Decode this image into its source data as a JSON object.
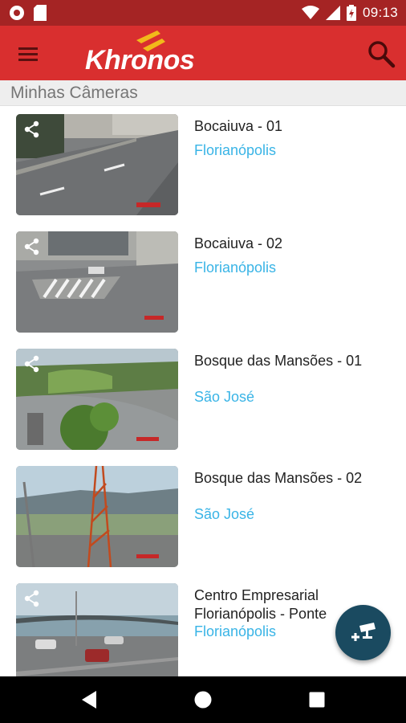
{
  "status_bar": {
    "time": "09:13",
    "icons": [
      "circle-notification-icon",
      "sd-card-icon",
      "wifi-icon",
      "signal-icon",
      "battery-icon"
    ]
  },
  "app_bar": {
    "brand": "Khronos",
    "menu_icon": "hamburger-menu-icon",
    "search_icon": "search-icon",
    "color": "#d92f2f"
  },
  "section": {
    "title": "Minhas Câmeras"
  },
  "cameras": [
    {
      "name": "Bocaiuva - 01",
      "city": "Florianópolis"
    },
    {
      "name": "Bocaiuva - 02",
      "city": "Florianópolis"
    },
    {
      "name": "Bosque das Mansões - 01",
      "city": "São José"
    },
    {
      "name": "Bosque das Mansões - 02",
      "city": "São José"
    },
    {
      "name": "Centro Empresarial Florianópolis - Ponte",
      "city": "Florianópolis"
    }
  ],
  "fab": {
    "icon": "add-camera-icon",
    "color": "#1a4a60"
  },
  "colors": {
    "city_link": "#39b4e6",
    "status_bar": "#a52424"
  }
}
